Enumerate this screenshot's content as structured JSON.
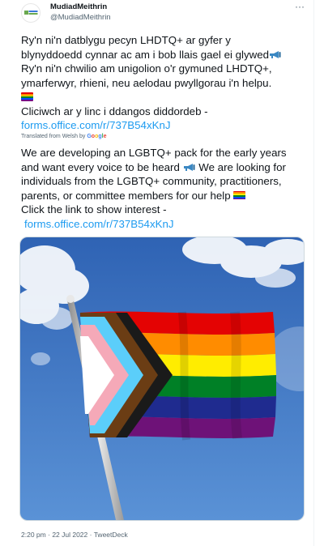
{
  "author": {
    "display_name": "MudiadMeithrin",
    "handle": "@MudiadMeithrin",
    "more_label": "···"
  },
  "tweet": {
    "welsh_lines": [
      "Ry'n ni'n datblygu pecyn LHDTQ+ ar gyfer y",
      "blynyddoedd cynnar ac am i bob llais gael ei glywed",
      "Ry'n ni'n chwilio am unigolion o'r gymuned LHDTQ+,",
      "ymarferwyr, rhieni, neu aelodau pwyllgorau i'n helpu.",
      "Cliciwch ar y linc i ddangos diddordeb -"
    ],
    "welsh_link": "forms.office.com/r/737B54xKnJ",
    "translated_label": "Translated from Welsh by",
    "translated_brand": "Google",
    "english_lines": [
      "We are developing an LGBTQ+ pack for the early years",
      "and want every voice to be heard",
      " We are looking for",
      "individuals from the LGBTQ+ community, practitioners,",
      "parents, or committee members for our help",
      " Click the link to show interest -"
    ],
    "english_link": "forms.office.com/r/737B54xKnJ"
  },
  "meta": {
    "time": "2:20 pm",
    "date": "22 Jul 2022",
    "source": "TweetDeck",
    "separator": "·"
  },
  "colors": {
    "link": "#1d9bf0",
    "secondary_text": "#536471",
    "sky_top": "#2f63b4",
    "sky_bottom": "#5a92d6"
  },
  "icons": {
    "emoji_1": "megaphone-icon",
    "emoji_2": "rainbow-flag-icon"
  }
}
